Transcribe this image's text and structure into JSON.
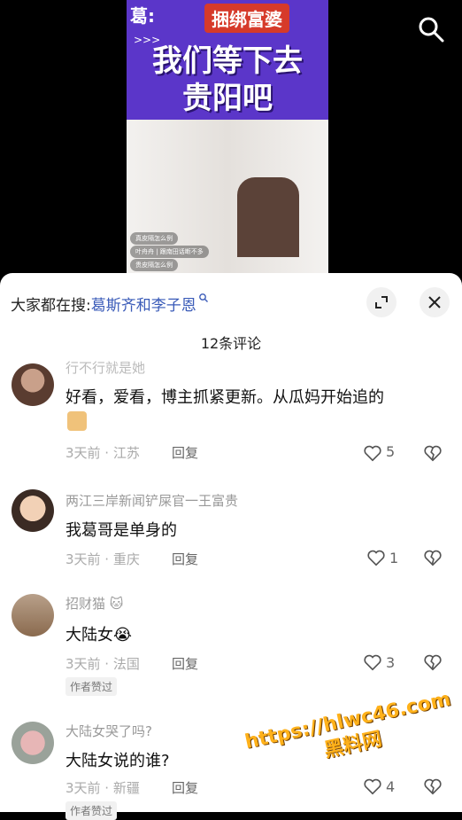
{
  "video": {
    "banner_tag": "葛:",
    "banner_tag2": "捆绑富婆",
    "arrows": ">>>",
    "headline_line1": "我们等下去",
    "headline_line2": "贵阳吧",
    "live_chat": [
      "真皮隔怎么例",
      "叶舟舟 | 跟南田话断不多",
      "贵皮隔怎么例"
    ]
  },
  "sheet": {
    "search_hint_prefix": "大家都在搜:",
    "search_hint_keyword": "葛斯齐和李子恩",
    "comment_count": "12条评论"
  },
  "comments": [
    {
      "username": "行不行就是她",
      "text": "好看，爱看，博主抓紧更新。从瓜妈开始追的",
      "time_location": "3天前 · 江苏",
      "reply": "回复",
      "likes": "5",
      "sticker": "cat-sticker"
    },
    {
      "username": "两江三岸新闻铲屎官一王富贵",
      "text": "我葛哥是单身的",
      "time_location": "3天前 · 重庆",
      "reply": "回复",
      "likes": "1"
    },
    {
      "username": "招财猫 🐱",
      "text": "大陆女😭",
      "time_location": "3天前 · 法国",
      "reply": "回复",
      "likes": "3",
      "badge": "作者赞过"
    },
    {
      "username": "大陆女哭了吗?",
      "text": "大陆女说的谁?",
      "time_location": "3天前 · 新疆",
      "reply": "回复",
      "likes": "4",
      "badge": "作者赞过"
    }
  ],
  "watermark": {
    "line1": "https://hlwc46.com",
    "line2": "黑料网"
  },
  "colors": {
    "banner_purple": "#5b36c9",
    "keyword_blue": "#3a5bb8",
    "watermark_orange": "#ffb11a"
  }
}
